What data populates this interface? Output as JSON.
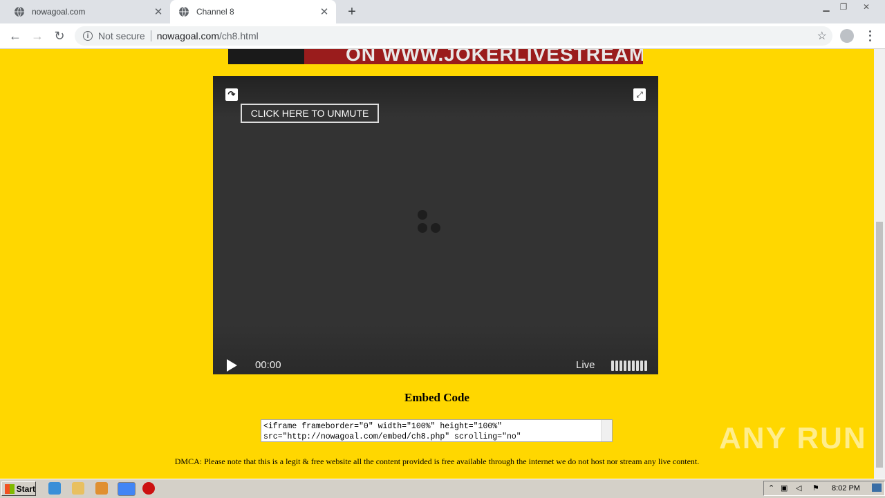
{
  "browser": {
    "tabs": [
      {
        "title": "nowagoal.com",
        "active": false
      },
      {
        "title": "Channel 8",
        "active": true
      }
    ],
    "address": {
      "security_label": "Not secure",
      "host": "nowagoal.com",
      "path": "/ch8.html"
    }
  },
  "page": {
    "banner_text": "ON WWW.JOKERLIVESTREAM.COM",
    "player": {
      "unmute_label": "CLICK HERE TO UNMUTE",
      "time": "00:00",
      "live_label": "Live"
    },
    "embed": {
      "title": "Embed Code",
      "code_line1": "<iframe frameborder=\"0\" width=\"100%\" height=\"100%\"",
      "code_line2": "src=\"http://nowagoal.com/embed/ch8.php\" scrolling=\"no\""
    },
    "dmca": "DMCA: Please note that this is a legit & free website all the content provided is free available through the internet we do not host nor stream any live content."
  },
  "watermark": "ANY RUN",
  "taskbar": {
    "start_label": "Start",
    "clock": "8:02 PM"
  },
  "colors": {
    "page_bg": "#ffd700",
    "player_bg": "#333333"
  }
}
